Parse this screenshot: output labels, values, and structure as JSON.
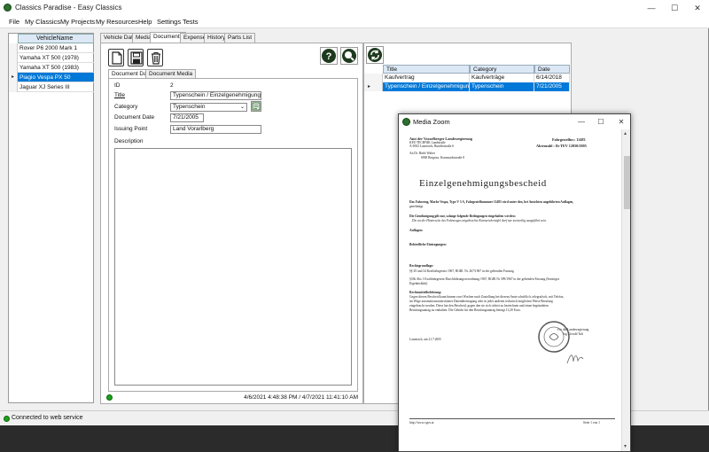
{
  "window": {
    "title": "Classics Paradise - Easy Classics",
    "controls": [
      "—",
      "☐",
      "✕"
    ]
  },
  "menu": [
    "File",
    "My Classics",
    "My Projects",
    "My Resources",
    "Help",
    "Settings",
    "Tests"
  ],
  "vehicle_list": {
    "header": "VehicleName",
    "rows": [
      "Rover P6 2000 Mark 1",
      "Yamaha  XT 500 (1978)",
      "Yamaha XT 500 (1983)",
      "Piagio Vespa PX 50",
      "Jaguar XJ Series III"
    ],
    "selected_index": 3,
    "row_indicator": "▸"
  },
  "tabs": [
    "Vehicle Data",
    "Media",
    "Documents",
    "Expenses",
    "History",
    "Parts List"
  ],
  "active_tab": "Documents",
  "toolbar": {
    "new": "new-document-icon",
    "save": "save-icon",
    "delete": "trash-icon",
    "help": "help-icon",
    "zoom": "zoom-icon",
    "refresh": "refresh-icon"
  },
  "subtabs": [
    "Document Data",
    "Document Media"
  ],
  "form": {
    "id_label": "ID",
    "id_value": "2",
    "title_label": "Title",
    "title_value": "Typenschein / Einzelgenehmigung",
    "category_label": "Category",
    "category_value": "Typenschein",
    "date_label": "Document Date",
    "date_value": "7/21/2005",
    "issuing_label": "Issuing Point",
    "issuing_value": "Land Vorarlberg",
    "description_label": "Description"
  },
  "status_line": "4/6/2021 4:48:38 PM / 4/7/2021 11:41:10 AM",
  "doc_grid": {
    "headers": [
      "Title",
      "Category",
      "Date"
    ],
    "rows": [
      [
        "Kaufvertrag",
        "Kaufverträge",
        "6/14/2018"
      ],
      [
        "Typenschein / Einzelgenehmigung",
        "Typenschein",
        "7/21/2005"
      ]
    ],
    "selected_index": 1,
    "row_indicator": "▸"
  },
  "bottom_status": "Connected to web service",
  "media_zoom": {
    "title": "Media Zoom",
    "controls": [
      "—",
      "☐",
      "✕"
    ],
    "doc": {
      "sender_1": "Amt der Vorarlberger Landesregierung",
      "sender_2": "KFZ-TECHNIK Landstraße",
      "sender_3": "A-6923 Lauterach, Bundesstraße 6",
      "ref_1": "Fahrgestellnr.: 11483",
      "ref_2": "Aktenzahl : Ib-TEV 12050/2005",
      "addr_1": "An    Dr. Härle Walter",
      "addr_2": "6900   Bregenz, Kornmarktstraße 8",
      "heading": "Einzelgenehmigungsbescheid",
      "p1": "Das Fahrzeug, Marke Vespa, Type V 5 A, Fahrgestellnummer 11483 wird unter den, bei Ansichten angeführten Auflagen,",
      "p1b": "genehmigt.",
      "p2": "Die Genehmigung gilt nur, solange folgende Bedingungen eingehalten werden:",
      "p2b": "Die an der Hinterseite des Fahrzeuges angebrachte Kennzeichentafel darf nur zweizeilig ausgeführt sein.",
      "p3": "Auflagen:",
      "p4": "Behördliche Eintragungen:",
      "p5": "Rechtsgrundlage:",
      "p5b": "§§ 29 und 34 Kraftfahrgesetz 1967, BGBl. Nr. 267/1967 in der geltenden Fassung",
      "p6": "§33b Abs 1 Kraftfahrgesetz-Durchführungsverordnung 1967, BGBl Nr 399/1967 in der geltenden Fassung (Sonstiges",
      "p6b": "Ergebnisblatt)",
      "p7": "Rechtsmittelbelehrung:",
      "p7b": "Gegen diesen Bescheid kann binnen zwei Wochen nach Zustellung bei diesem Amte schriftlich, telegrafisch, mit Telefax,",
      "p7c": "im Wege automationsunterstützter Datenübertragung oder in jeder anderen technisch möglichen Weise Berufung",
      "p7d": "eingebracht werden. Diese hat den Bescheid, gegen den sie sich richtet zu bezeichnen und einen begründeten",
      "p7e": "Berufungsantrag zu enthalten. Die Gebühr für den Berufungsantrag beträgt 13,20 Euro.",
      "sign_1": "Für die Landesregierung",
      "sign_2": "Ing. Gerald Tuli",
      "place_date": "Lauterach, am 21.7.2005",
      "footer_left": "http://www.vgov.at",
      "footer_right": "Seite 1 von 1"
    }
  },
  "colors": {
    "selection": "#0078d7",
    "grid_header": "#dce8f5",
    "status_green": "#1fa01f",
    "app_icon": "#2e6e2e"
  }
}
